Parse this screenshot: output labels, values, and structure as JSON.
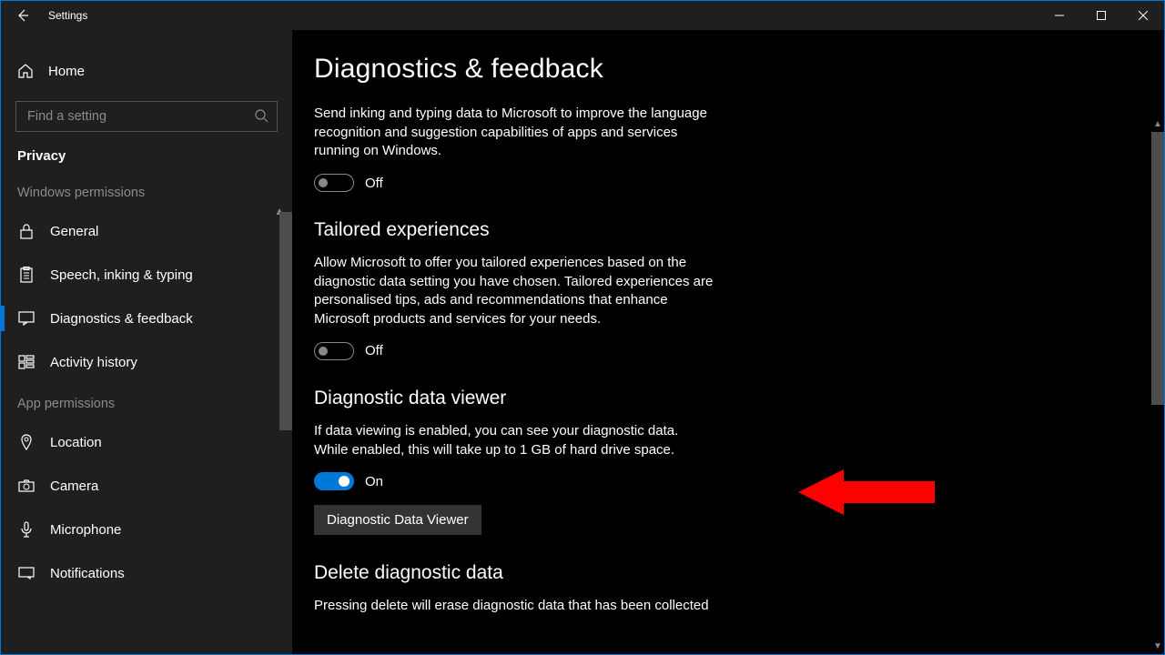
{
  "window": {
    "title": "Settings"
  },
  "sidebar": {
    "home": "Home",
    "search_placeholder": "Find a setting",
    "category": "Privacy",
    "group1": "Windows permissions",
    "items1": [
      {
        "label": "General"
      },
      {
        "label": "Speech, inking & typing"
      },
      {
        "label": "Diagnostics & feedback"
      },
      {
        "label": "Activity history"
      }
    ],
    "group2": "App permissions",
    "items2": [
      {
        "label": "Location"
      },
      {
        "label": "Camera"
      },
      {
        "label": "Microphone"
      },
      {
        "label": "Notifications"
      }
    ]
  },
  "page": {
    "title": "Diagnostics & feedback",
    "improve_typing_desc": "Send inking and typing data to Microsoft to improve the language recognition and suggestion capabilities of apps and services running on Windows.",
    "improve_typing_state": "Off",
    "tailored_heading": "Tailored experiences",
    "tailored_desc": "Allow Microsoft to offer you tailored experiences based on the diagnostic data setting you have chosen. Tailored experiences are personalised tips, ads and recommendations that enhance Microsoft products and services for your needs.",
    "tailored_state": "Off",
    "viewer_heading": "Diagnostic data viewer",
    "viewer_desc": "If data viewing is enabled, you can see your diagnostic data. While enabled, this will take up to 1 GB of hard drive space.",
    "viewer_state": "On",
    "viewer_button": "Diagnostic Data Viewer",
    "delete_heading": "Delete diagnostic data",
    "delete_desc": "Pressing delete will erase diagnostic data that has been collected"
  }
}
